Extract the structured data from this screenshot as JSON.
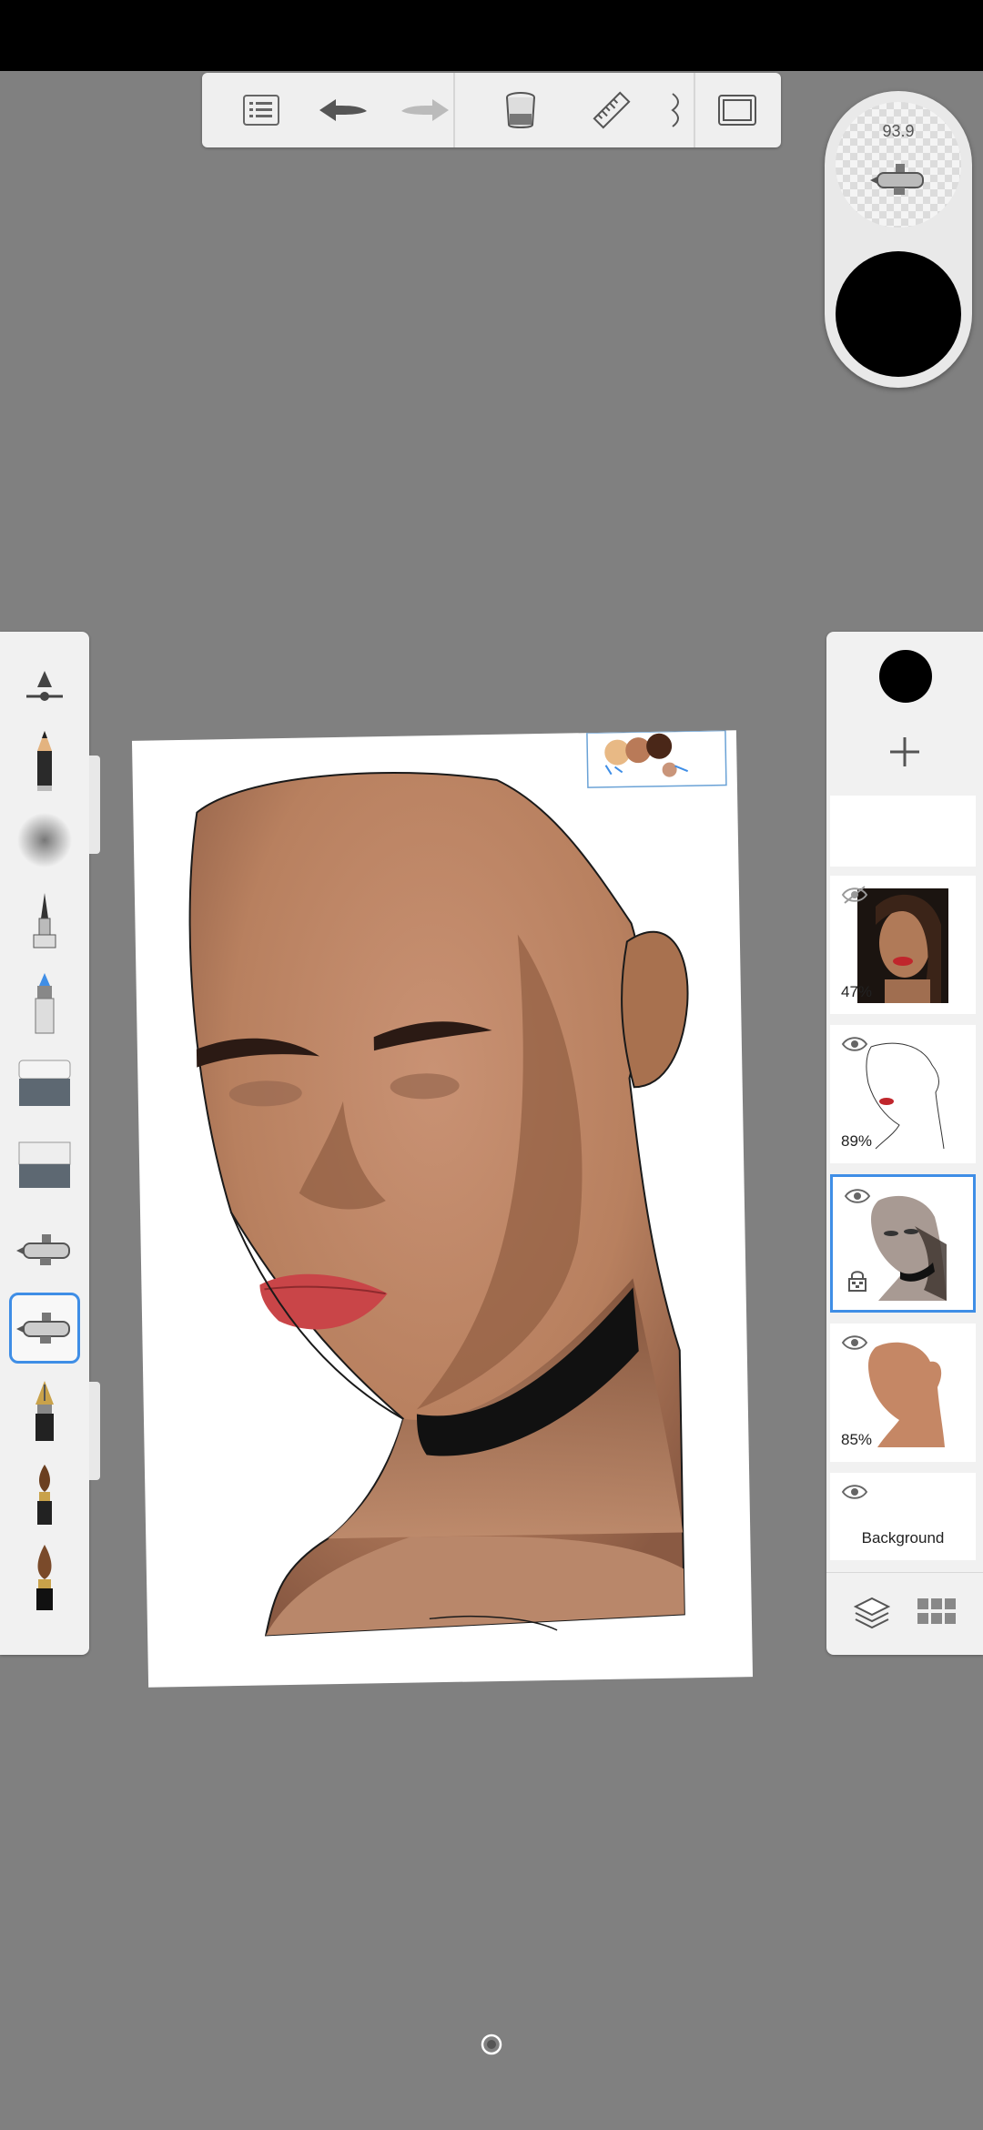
{
  "app": {
    "brush_puck": {
      "size_value": "93.9",
      "color": "#000000"
    },
    "accent": "#3f8ee6"
  },
  "top_toolbar": {
    "items": [
      "list-icon",
      "undo-icon",
      "redo-icon",
      "paint-bucket-icon",
      "ruler-icon",
      "symmetry-icon",
      "fullscreen-icon"
    ]
  },
  "left_toolbar": {
    "tools": [
      "brush-settings-icon",
      "pencil-icon",
      "airbrush-spray-icon",
      "ink-pen-icon",
      "marker-icon",
      "hard-eraser-icon",
      "soft-eraser-icon",
      "airbrush-icon",
      "airbrush-selected-icon",
      "fountain-pen-icon",
      "paintbrush-icon",
      "round-brush-icon"
    ],
    "selected_index": 8
  },
  "layers": [
    {
      "name": "",
      "opacity": "",
      "visible": true,
      "thumb": "blank"
    },
    {
      "name": "",
      "opacity": "47%",
      "visible": false,
      "thumb": "reference-photo"
    },
    {
      "name": "",
      "opacity": "89%",
      "visible": true,
      "thumb": "line-art"
    },
    {
      "name": "",
      "opacity": "",
      "visible": true,
      "thumb": "shading",
      "locked": true,
      "selected": true
    },
    {
      "name": "",
      "opacity": "85%",
      "visible": true,
      "thumb": "base-color"
    },
    {
      "name": "Background",
      "opacity": "",
      "visible": true,
      "thumb": "background"
    }
  ],
  "colors": {
    "skin": "#c7906f",
    "skin_dark": "#8a5a43",
    "lips": "#c94548",
    "swatch_1": "#e8b985",
    "swatch_2": "#b97a58",
    "swatch_3": "#4a2718"
  }
}
